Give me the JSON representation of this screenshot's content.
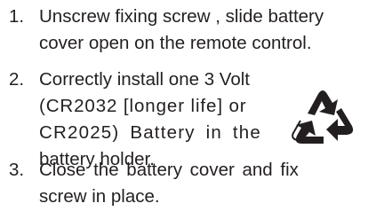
{
  "steps": [
    {
      "number": "1.",
      "lines": [
        "Unscrew fixing screw , slide battery",
        "cover open on the remote control."
      ]
    },
    {
      "number": "2.",
      "lines": [
        "Correctly install one 3 Volt",
        "(CR2032 [longer life] or",
        "CR2025) Battery in the",
        "battery holder."
      ]
    },
    {
      "number": "3.",
      "lines": [
        "Close the battery cover and fix",
        "screw in place."
      ]
    }
  ],
  "recycle_icon": "recycle-icon",
  "colors": {
    "text": "#231f20",
    "background": "#ffffff"
  }
}
